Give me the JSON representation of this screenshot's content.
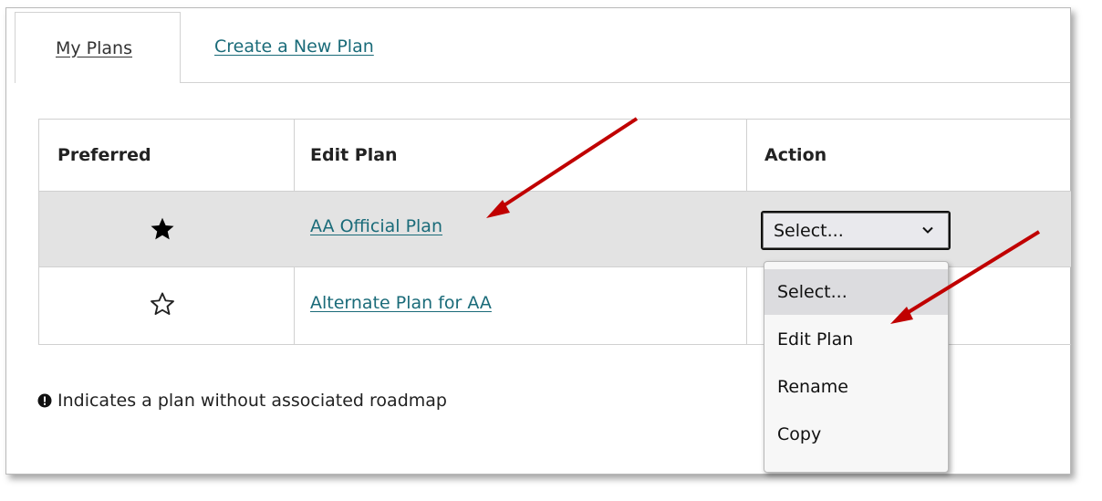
{
  "tabs": {
    "my_plans": "My Plans",
    "create_new": "Create a New Plan"
  },
  "table": {
    "headers": [
      "Preferred",
      "Edit Plan",
      "Action"
    ],
    "rows": [
      {
        "preferred": true,
        "plan": "AA Official Plan",
        "action": "Select..."
      },
      {
        "preferred": false,
        "plan": "Alternate Plan for AA"
      }
    ]
  },
  "dropdown": {
    "options": [
      "Select...",
      "Edit Plan",
      "Rename",
      "Copy"
    ],
    "selected": "Select..."
  },
  "footnote": "Indicates a plan without associated roadmap",
  "icons": {
    "filled_star": "star-filled-icon",
    "empty_star": "star-outline-icon",
    "chevron": "chevron-down-icon",
    "info": "exclamation-circle-icon"
  },
  "colors": {
    "link": "#1a6b79",
    "annotation_arrow": "#c00000",
    "selected_row": "#e3e3e3"
  }
}
